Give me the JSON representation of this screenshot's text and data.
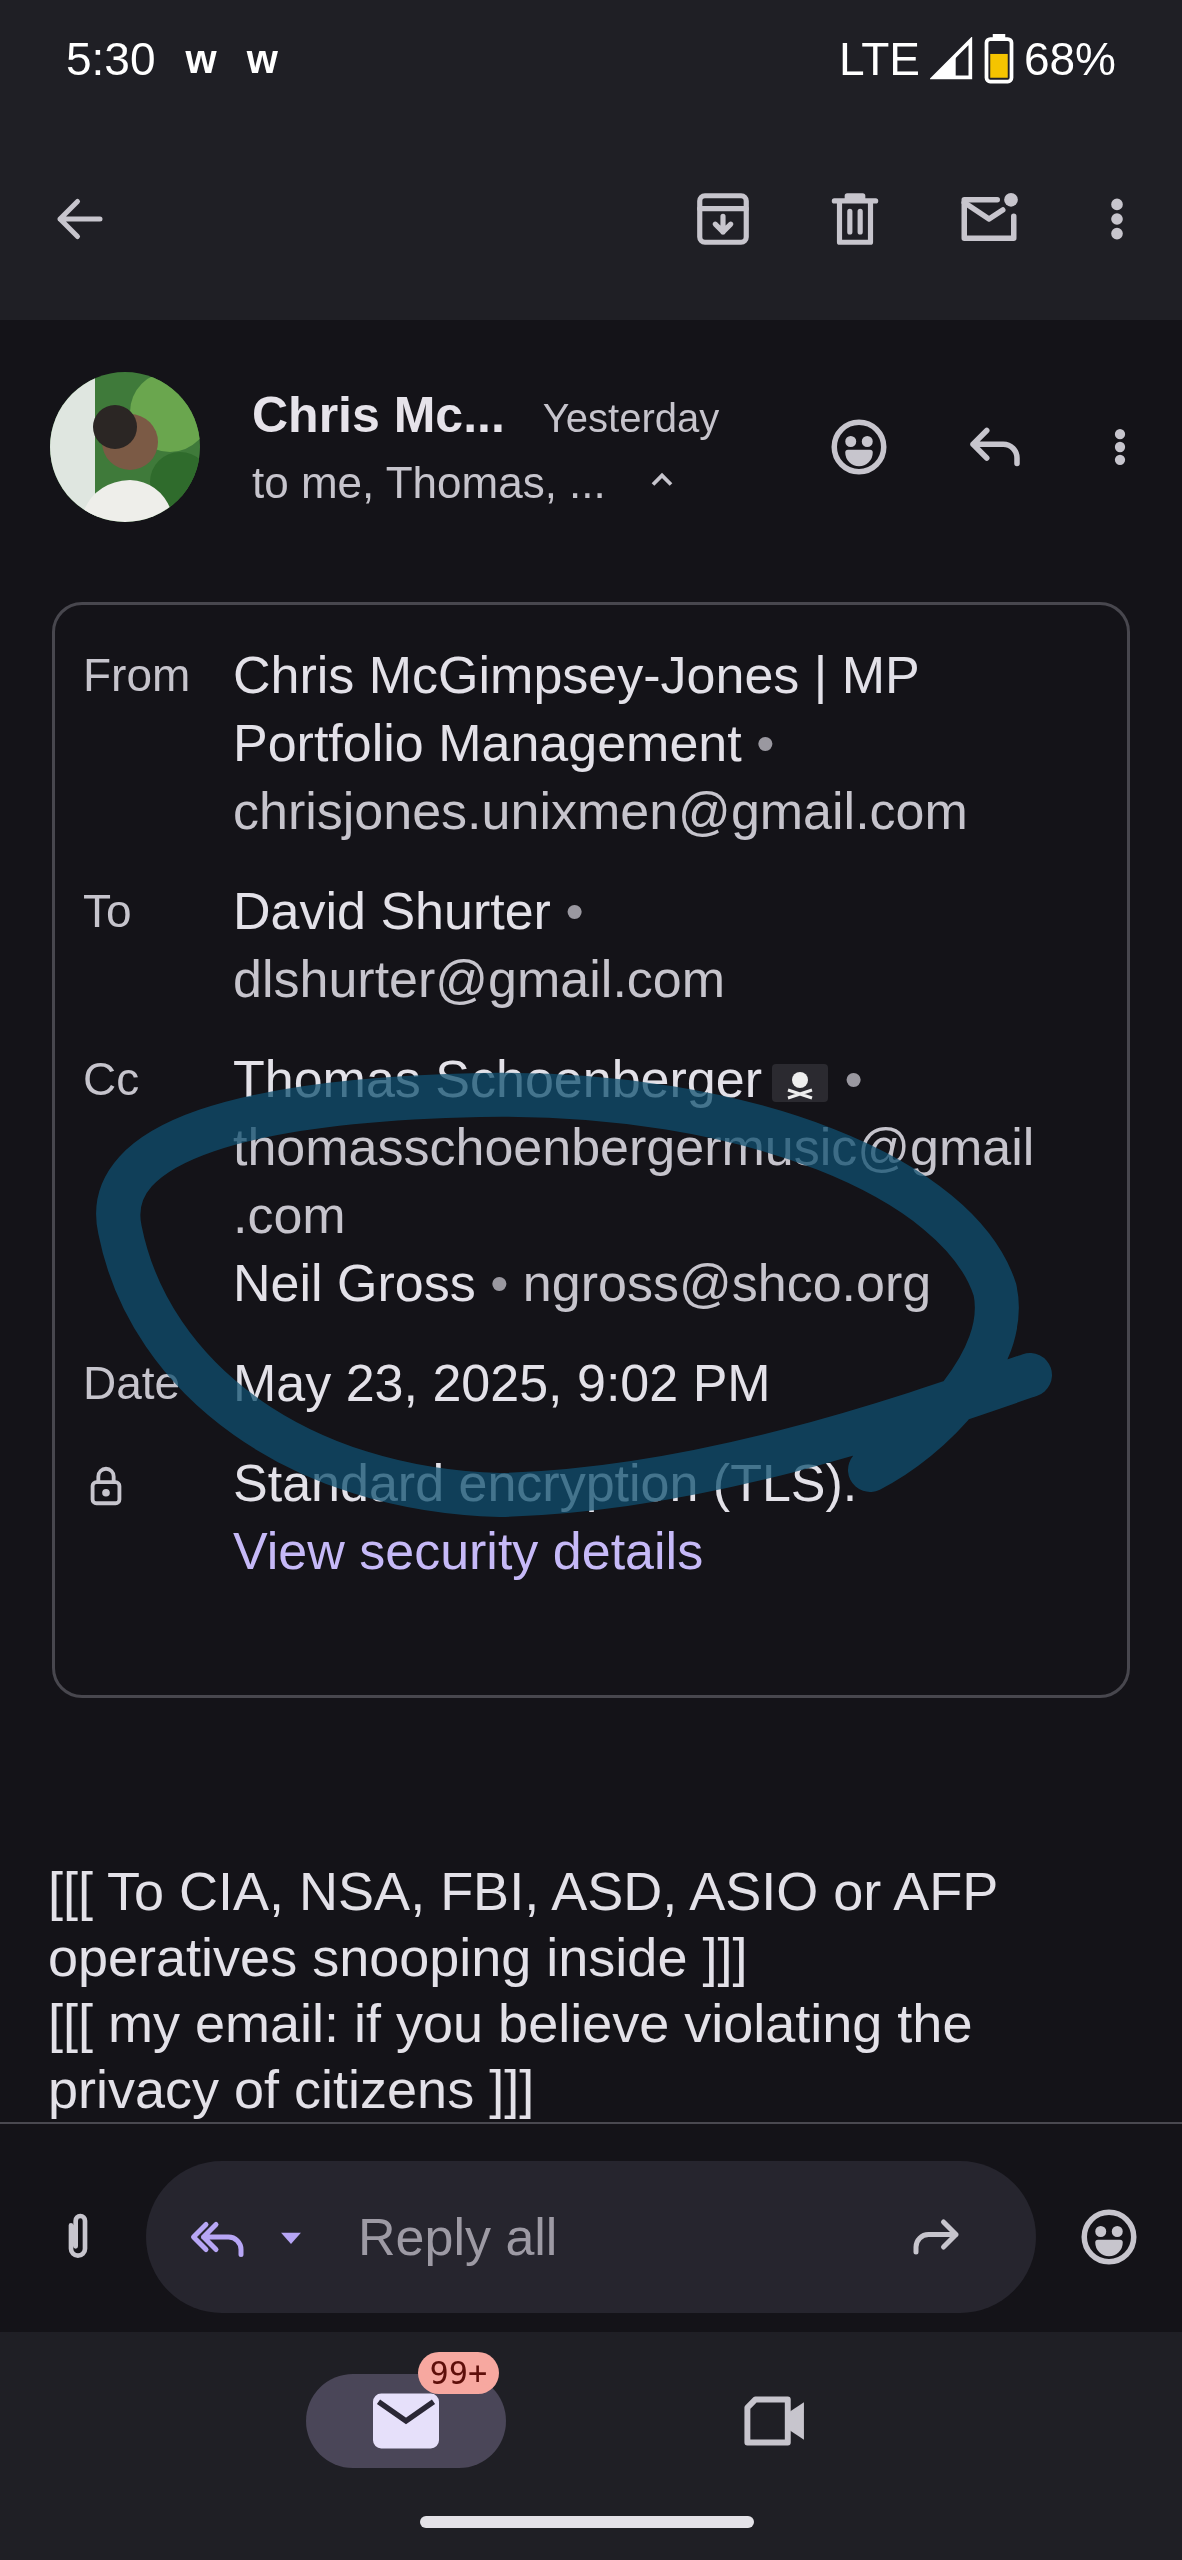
{
  "status_bar": {
    "time": "5:30",
    "notifications": [
      "w",
      "w"
    ],
    "network": "LTE",
    "battery": "68%"
  },
  "header": {
    "sender": "Chris Mc...",
    "time": "Yesterday",
    "recipients": "to me, Thomas, ...",
    "expanded": true
  },
  "details": {
    "separator": "•",
    "rows": [
      {
        "kind": "people",
        "label": "From",
        "people": [
          {
            "name": "Chris McGimpsey-Jones | MP Portfolio Management",
            "email": "chrisjones.unixmen@gmail.com",
            "flag": false
          }
        ]
      },
      {
        "kind": "people",
        "label": "To",
        "people": [
          {
            "name": "David Shurter",
            "email": "dlshurter@gmail.com",
            "flag": false
          }
        ]
      },
      {
        "kind": "people",
        "label": "Cc",
        "people": [
          {
            "name": "Thomas Schoenberger",
            "email": "thomasschoenbergermusic@gmail.com",
            "flag": true
          },
          {
            "name": "Neil Gross",
            "email": "ngross@shco.org",
            "flag": false
          }
        ]
      },
      {
        "kind": "date",
        "label": "Date",
        "value": "May 23, 2025, 9:02 PM"
      },
      {
        "kind": "security",
        "value": "Standard encryption (TLS).",
        "link": "View security details"
      }
    ]
  },
  "body": [
    "[[[ To CIA, NSA, FBI, ASD, ASIO or AFP operatives snooping inside ]]]",
    "[[[ my email: if you believe violating the privacy of citizens ]]]"
  ],
  "compose": {
    "placeholder": "Reply all"
  },
  "bottom_nav": [
    {
      "kind": "mail",
      "selected": true,
      "badge": "99+"
    },
    {
      "kind": "meet",
      "selected": false
    }
  ]
}
